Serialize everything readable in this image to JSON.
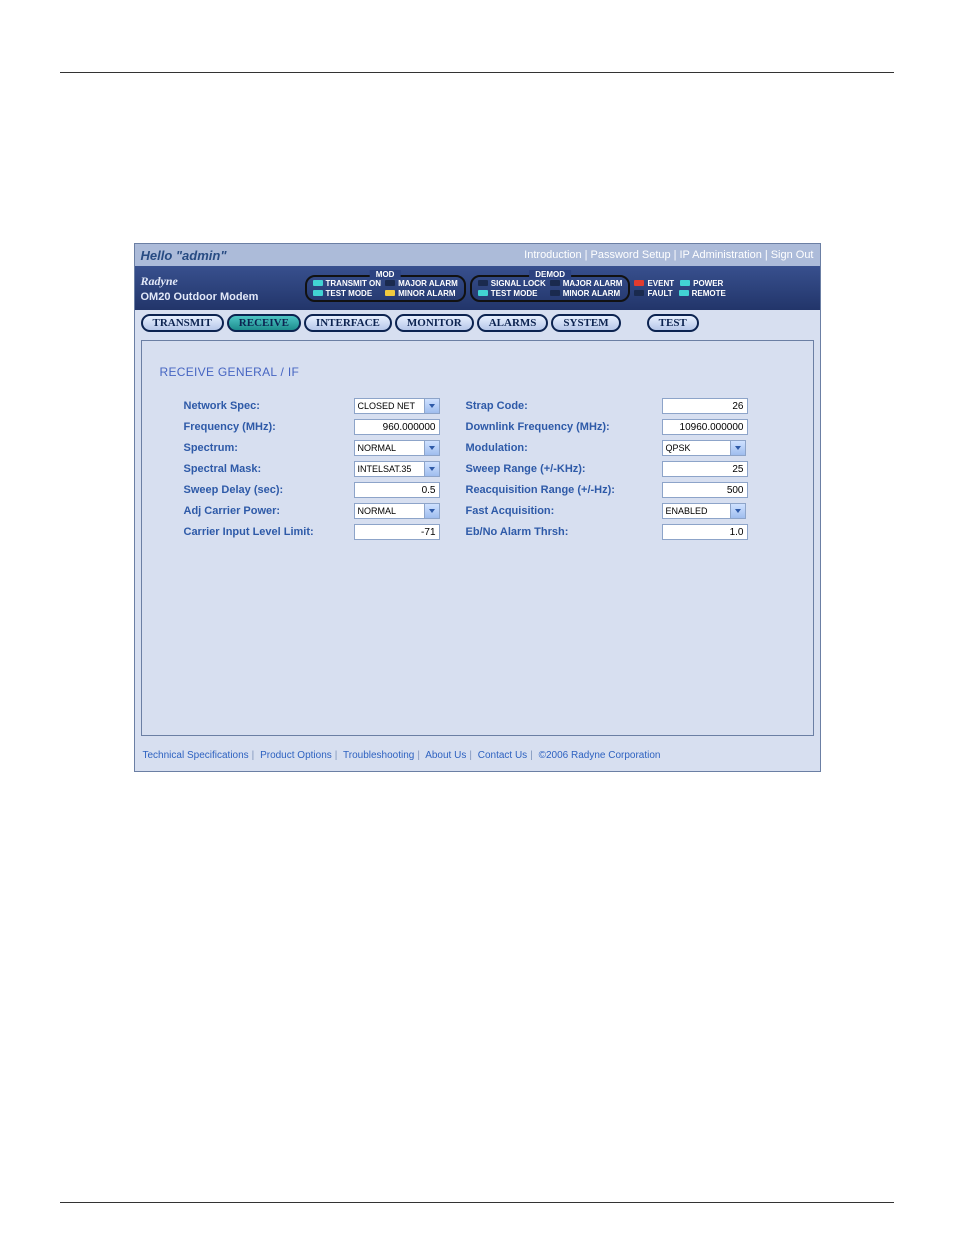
{
  "top_bar": {
    "hello": "Hello \"admin\"",
    "links": [
      "Introduction",
      "Password Setup",
      "IP Administration",
      "Sign Out"
    ]
  },
  "brand": {
    "logo": "Radyne",
    "product": "OM20 Outdoor Modem"
  },
  "status_groups": {
    "mod": {
      "title": "MOD",
      "items": [
        {
          "label": "TRANSMIT ON",
          "led": "teal"
        },
        {
          "label": "TEST MODE",
          "led": "teal"
        },
        {
          "label": "MAJOR ALARM",
          "led": "dark"
        },
        {
          "label": "MINOR ALARM",
          "led": "yellow"
        }
      ]
    },
    "demod": {
      "title": "DEMOD",
      "items": [
        {
          "label": "SIGNAL LOCK",
          "led": "dark"
        },
        {
          "label": "TEST MODE",
          "led": "teal"
        },
        {
          "label": "MAJOR ALARM",
          "led": "dark"
        },
        {
          "label": "MINOR ALARM",
          "led": "dark"
        }
      ]
    },
    "system": {
      "items": [
        {
          "label": "EVENT",
          "led": "red"
        },
        {
          "label": "FAULT",
          "led": "dark"
        },
        {
          "label": "POWER",
          "led": "teal"
        },
        {
          "label": "REMOTE",
          "led": "teal"
        }
      ]
    }
  },
  "tabs": [
    "TRANSMIT",
    "RECEIVE",
    "INTERFACE",
    "MONITOR",
    "ALARMS",
    "SYSTEM",
    "TEST"
  ],
  "active_tab": "RECEIVE",
  "section_title": "RECEIVE GENERAL / IF",
  "left_fields": [
    {
      "label": "Network Spec:",
      "type": "select",
      "value": "CLOSED NET"
    },
    {
      "label": "Frequency (MHz):",
      "type": "text",
      "value": "960.000000"
    },
    {
      "label": "Spectrum:",
      "type": "select",
      "value": "NORMAL"
    },
    {
      "label": "Spectral Mask:",
      "type": "select",
      "value": "INTELSAT.35"
    },
    {
      "label": "Sweep Delay (sec):",
      "type": "text",
      "value": "0.5"
    },
    {
      "label": "Adj Carrier Power:",
      "type": "select",
      "value": "NORMAL"
    },
    {
      "label": "Carrier Input Level Limit:",
      "type": "text",
      "value": "-71"
    }
  ],
  "right_fields": [
    {
      "label": "Strap Code:",
      "type": "text",
      "value": "26"
    },
    {
      "label": "Downlink Frequency (MHz):",
      "type": "text",
      "value": "10960.000000"
    },
    {
      "label": "Modulation:",
      "type": "select",
      "value": "QPSK"
    },
    {
      "label": "Sweep Range (+/-KHz):",
      "type": "text",
      "value": "25"
    },
    {
      "label": "Reacquisition Range (+/-Hz):",
      "type": "text",
      "value": "500"
    },
    {
      "label": "Fast Acquisition:",
      "type": "select",
      "value": "ENABLED"
    },
    {
      "label": "Eb/No Alarm Thrsh:",
      "type": "text",
      "value": "1.0"
    }
  ],
  "footer_links": [
    "Technical Specifications",
    "Product Options",
    "Troubleshooting",
    "About Us",
    "Contact Us",
    "©2006 Radyne Corporation"
  ]
}
